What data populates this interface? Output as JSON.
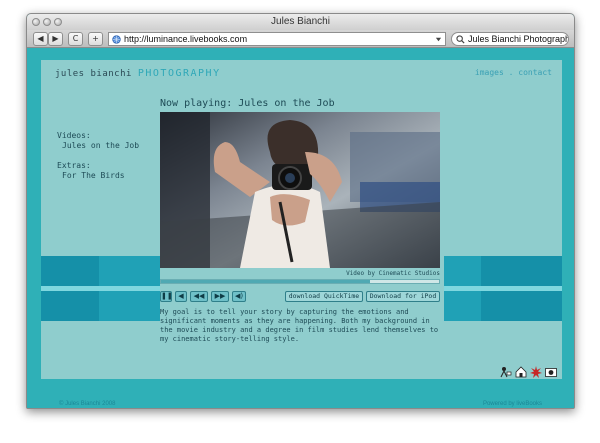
{
  "window": {
    "title": "Jules Bianchi"
  },
  "toolbar": {
    "back_label": "◀",
    "forward_label": "▶",
    "reload_label": "C",
    "add_label": "+",
    "url": "http://luminance.livebooks.com",
    "search": "Jules Bianchi Photography"
  },
  "site": {
    "name": "jules bianchi",
    "name_accent": "PHOTOGRAPHY",
    "nav": [
      "images",
      "contact"
    ],
    "nav_separator": "."
  },
  "sidebar": {
    "videos_heading": "Videos:",
    "videos": [
      "Jules on the Job"
    ],
    "extras_heading": "Extras:",
    "extras": [
      "For The Birds"
    ]
  },
  "player": {
    "now_playing": "Now playing: Jules on the Job",
    "credit": "Video by Cinematic Studios",
    "progress": 0.75,
    "buttons": [
      "download QuickTime",
      "Download for iPod"
    ]
  },
  "description": "My goal is to tell your story by capturing the emotions and significant moments as they are happening. Both my background in the movie industry and a degree in film studies lend themselves to my cinematic story-telling style.",
  "footer": {
    "copyright": "© Jules Bianchi 2008",
    "powered": "Powered by liveBooks"
  },
  "colors": {
    "page_bg": "#2fb0b7",
    "panel_bg": "#8fcdcd",
    "accent": "#2fa8b8"
  }
}
